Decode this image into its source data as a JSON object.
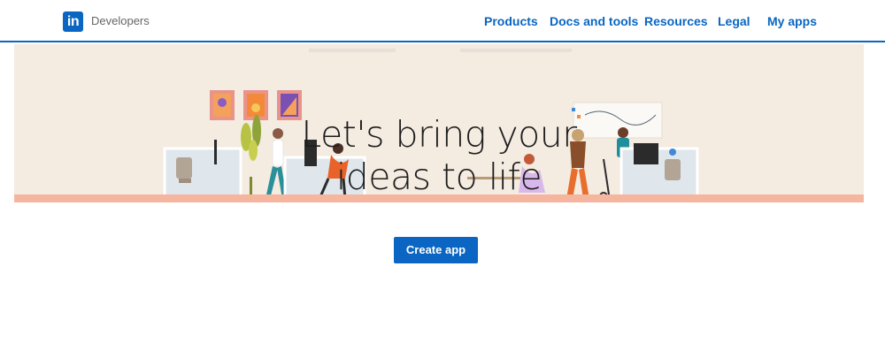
{
  "header": {
    "logo_text": "in",
    "brand": "Developers",
    "nav": [
      {
        "label": "Products"
      },
      {
        "label": "Docs and tools"
      },
      {
        "label": "Resources"
      },
      {
        "label": "Legal"
      },
      {
        "label": "My apps"
      }
    ]
  },
  "hero": {
    "title": "Let's bring your\nideas to life"
  },
  "actions": {
    "create_app_label": "Create app"
  },
  "colors": {
    "brand_blue": "#0a66c2",
    "hero_bg": "#f4ebe1",
    "hero_floor": "#f6b59f"
  }
}
